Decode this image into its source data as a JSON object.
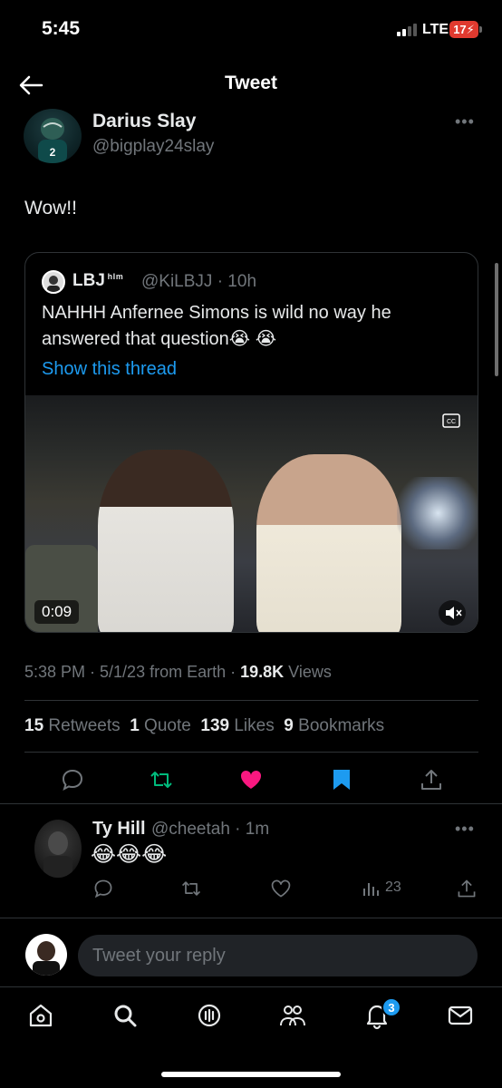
{
  "status_bar": {
    "time": "5:45",
    "network": "LTE",
    "battery": "17"
  },
  "header": {
    "title": "Tweet"
  },
  "tweet": {
    "author_name": "Darius Slay",
    "author_handle": "@bigplay24slay",
    "text": "Wow!!",
    "quote": {
      "name": "LBJ",
      "name_suffix": "ʰᴵᵐ",
      "handle_time": "@KiLBJJ · 10h",
      "text": "NAHHH Anfernee Simons is wild no way he answered that question😭 😭",
      "show_thread": "Show this thread",
      "video_duration": "0:09"
    },
    "meta": {
      "time_date_source": "5:38 PM · 5/1/23 from Earth · ",
      "views_count": "19.8K",
      "views_label": " Views"
    },
    "stats": {
      "retweets_count": "15",
      "retweets_label": "Retweets",
      "quotes_count": "1",
      "quotes_label": "Quote",
      "likes_count": "139",
      "likes_label": "Likes",
      "bookmarks_count": "9",
      "bookmarks_label": "Bookmarks"
    },
    "actions": {
      "reply_icon": "comment-icon",
      "retweet_icon": "retweet-icon",
      "like_icon": "heart-filled-icon",
      "bookmark_icon": "bookmark-filled-icon",
      "share_icon": "share-icon",
      "retweet_color": "#00ba7c",
      "like_color": "#f91880",
      "bookmark_color": "#1d9bf0"
    }
  },
  "reply": {
    "name": "Ty Hill",
    "handle_time": "@cheetah · 1m",
    "text": "😂😂😂",
    "views": "23"
  },
  "composer": {
    "placeholder": "Tweet your reply"
  },
  "tab_bar": {
    "notifications_badge": "3"
  },
  "colors": {
    "accent": "#1d9bf0",
    "background": "#000000",
    "muted": "#71767b"
  }
}
